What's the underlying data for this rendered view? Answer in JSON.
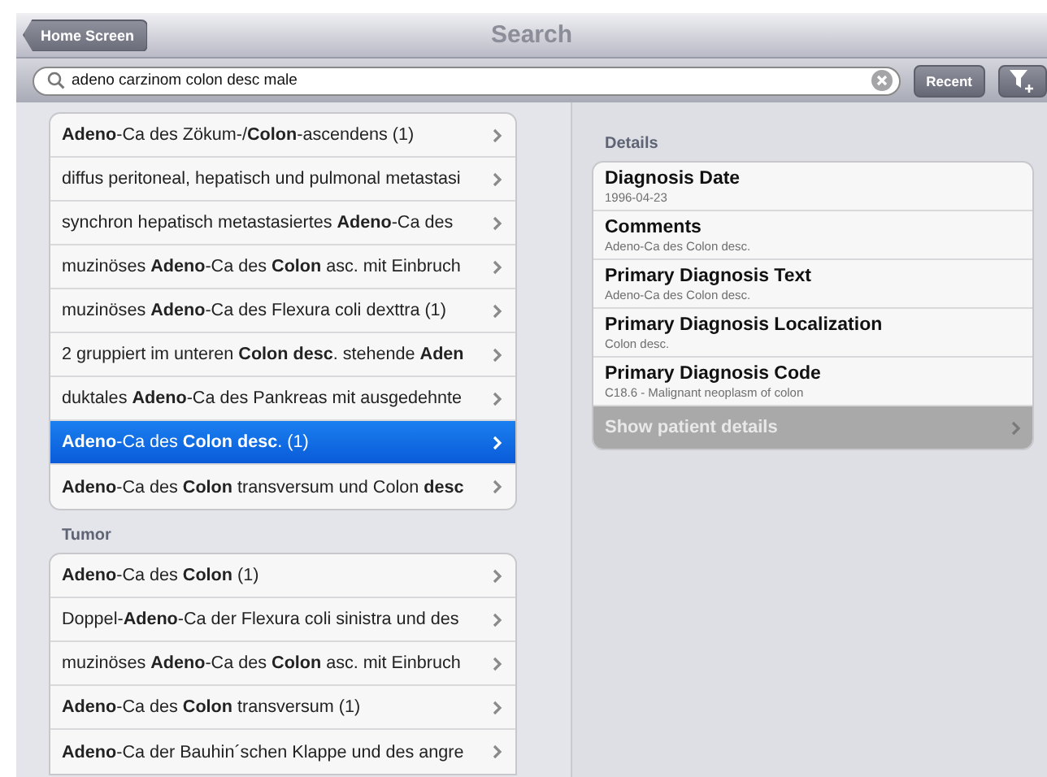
{
  "nav_bar": {
    "back_button": "Home Screen",
    "title": "Search"
  },
  "search": {
    "value": "adeno carzinom colon desc male",
    "recent_button": "Recent"
  },
  "results": [
    {
      "text": "**Adeno**-Ca des Zökum-/**Colon**-ascendens (1)",
      "selected": false
    },
    {
      "text": "diffus peritoneal, hepatisch und pulmonal metastasi",
      "selected": false
    },
    {
      "text": "synchron hepatisch metastasiertes **Adeno**-Ca des",
      "selected": false
    },
    {
      "text": "muzinöses **Adeno**-Ca des **Colon** asc. mit Einbruch",
      "selected": false
    },
    {
      "text": "muzinöses **Adeno**-Ca des Flexura coli dexttra (1)",
      "selected": false
    },
    {
      "text": "2 gruppiert im unteren **Colon desc**. stehende **Aden**",
      "selected": false
    },
    {
      "text": "duktales **Adeno**-Ca des Pankreas mit ausgedehnte",
      "selected": false
    },
    {
      "text": "**Adeno**-Ca des **Colon desc**. (1)",
      "selected": true
    },
    {
      "text": "**Adeno**-Ca des **Colon** transversum und Colon **desc**",
      "selected": false
    }
  ],
  "tumor_section": {
    "title": "Tumor",
    "items": [
      {
        "text": "**Adeno**-Ca des **Colon** (1)",
        "selected": false
      },
      {
        "text": "Doppel-**Adeno**-Ca der Flexura coli sinistra und des",
        "selected": false
      },
      {
        "text": "muzinöses **Adeno**-Ca des **Colon** asc. mit Einbruch",
        "selected": false
      },
      {
        "text": "**Adeno**-Ca des **Colon** transversum (1)",
        "selected": false
      },
      {
        "text": "**Adeno**-Ca der Bauhin´schen Klappe und des angre",
        "selected": false
      }
    ]
  },
  "details": {
    "title": "Details",
    "fields": [
      {
        "label": "Diagnosis Date",
        "value": "1996-04-23"
      },
      {
        "label": "Comments",
        "value": "Adeno-Ca des Colon desc."
      },
      {
        "label": "Primary Diagnosis Text",
        "value": "Adeno-Ca des Colon desc."
      },
      {
        "label": "Primary Diagnosis Localization",
        "value": "Colon desc."
      },
      {
        "label": "Primary Diagnosis Code",
        "value": "C18.6 - Malignant neoplasm of colon"
      }
    ],
    "action": "Show patient details"
  }
}
